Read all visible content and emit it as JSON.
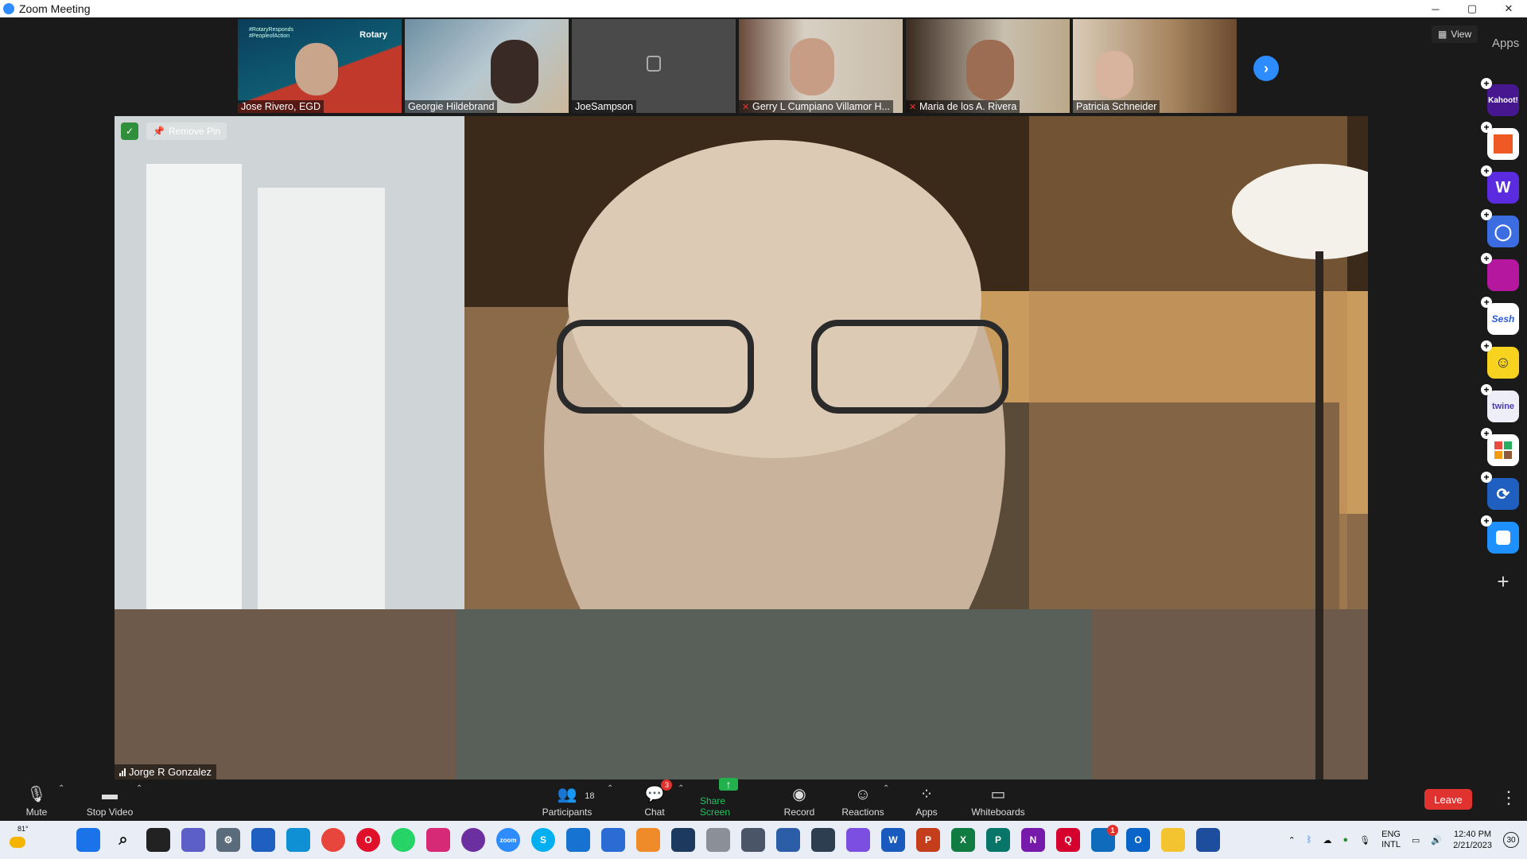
{
  "window": {
    "title": "Zoom Meeting",
    "controls": [
      "─",
      "▢",
      "✕"
    ]
  },
  "gallery": {
    "tiles": [
      {
        "name": "Jose Rivero, EGD",
        "muted": false,
        "overlay_lines": [
          "#RotaryResponds",
          "#PeopleofAction"
        ],
        "logo_text": "Rotary"
      },
      {
        "name": "Georgie Hildebrand",
        "muted": false
      },
      {
        "name": "JoeSampson",
        "muted": false
      },
      {
        "name": "Gerry L Cumpiano Villamor H...",
        "muted": true
      },
      {
        "name": "Maria de los A. Rivera",
        "muted": true
      },
      {
        "name": "Patricia Schneider",
        "muted": false
      }
    ],
    "next_label": "›"
  },
  "view_button": "View",
  "apps_label": "Apps",
  "main_video": {
    "participant_name": "Jorge R Gonzalez",
    "remove_pin_label": "Remove Pin"
  },
  "apps_rail": [
    {
      "label": "Kahoot!",
      "color": "#46178f"
    },
    {
      "label": "",
      "color": "#ffffff"
    },
    {
      "label": "W",
      "color": "#5b2be0"
    },
    {
      "label": "◯",
      "color": "#3b6ce0"
    },
    {
      "label": "",
      "color": "#b5179e"
    },
    {
      "label": "Sesh",
      "color": "#ffffff"
    },
    {
      "label": "☺",
      "color": "#f7d21e"
    },
    {
      "label": "twine",
      "color": "#eeeef8"
    },
    {
      "label": "",
      "color": "#ffffff"
    },
    {
      "label": "⟳",
      "color": "#1f5fbf"
    },
    {
      "label": "",
      "color": "#1e90ff"
    }
  ],
  "toolbar": {
    "mute": "Mute",
    "stop_video": "Stop Video",
    "participants": "Participants",
    "participants_count": "18",
    "chat": "Chat",
    "chat_badge": "3",
    "share_screen": "Share Screen",
    "record": "Record",
    "reactions": "Reactions",
    "apps": "Apps",
    "whiteboards": "Whiteboards",
    "leave": "Leave"
  },
  "taskbar": {
    "weather_temp": "81°",
    "lang_top": "ENG",
    "lang_bottom": "INTL",
    "time": "12:40 PM",
    "date": "2/21/2023",
    "notification_count": "30",
    "mail_badge": "1"
  }
}
